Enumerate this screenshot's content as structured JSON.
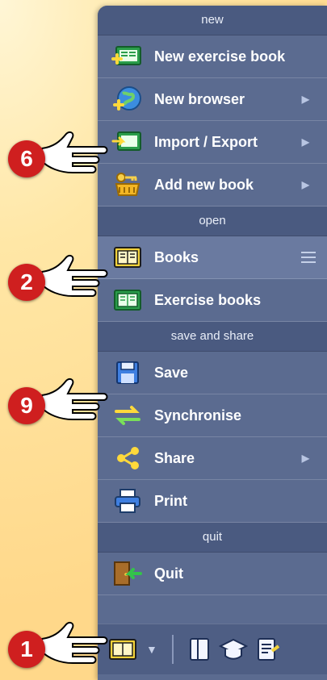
{
  "sections": {
    "new": "new",
    "open": "open",
    "save_share": "save and share",
    "quit": "quit"
  },
  "items": {
    "new_exercise_book": "New exercise book",
    "new_browser": "New browser",
    "import_export": "Import / Export",
    "add_new_book": "Add new book",
    "books": "Books",
    "exercise_books": "Exercise books",
    "save": "Save",
    "synchronise": "Synchronise",
    "share": "Share",
    "print": "Print",
    "quit": "Quit"
  },
  "callouts": {
    "c6": "6",
    "c2": "2",
    "c9": "9",
    "c1": "1"
  },
  "toolbar": {
    "icons": [
      "book-icon",
      "chevron-down-icon",
      "folder-icon",
      "graduation-cap-icon",
      "notes-icon"
    ]
  },
  "colors": {
    "menu_bg": "#5b6b90",
    "header_bg": "#4a5a80",
    "badge_red": "#cf1f1f"
  }
}
